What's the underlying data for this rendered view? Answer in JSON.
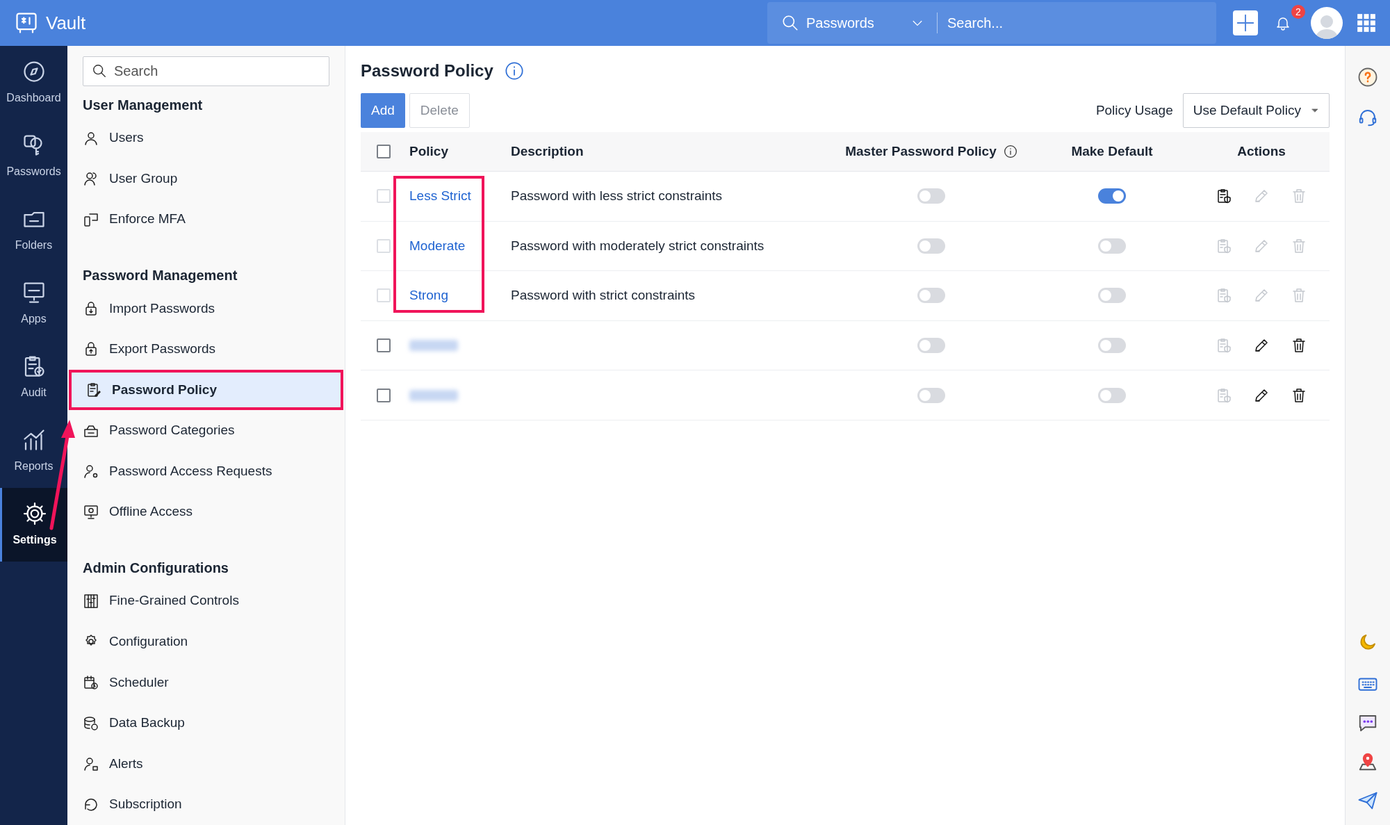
{
  "app": {
    "name": "Vault"
  },
  "top_bar": {
    "search_scope": "Passwords",
    "search_placeholder": "Search...",
    "notification_count": "2"
  },
  "nav_rail": [
    {
      "label": "Dashboard",
      "selected": false
    },
    {
      "label": "Passwords",
      "selected": false
    },
    {
      "label": "Folders",
      "selected": false
    },
    {
      "label": "Apps",
      "selected": false
    },
    {
      "label": "Audit",
      "selected": false
    },
    {
      "label": "Reports",
      "selected": false
    },
    {
      "label": "Settings",
      "selected": true
    }
  ],
  "settings_menu": {
    "search_placeholder": "Search",
    "sections": [
      {
        "title": "User Management",
        "items": [
          {
            "label": "Users",
            "selected": false
          },
          {
            "label": "User Group",
            "selected": false
          },
          {
            "label": "Enforce MFA",
            "selected": false
          }
        ]
      },
      {
        "title": "Password Management",
        "items": [
          {
            "label": "Import Passwords",
            "selected": false
          },
          {
            "label": "Export Passwords",
            "selected": false
          },
          {
            "label": "Password Policy",
            "selected": true
          },
          {
            "label": "Password Categories",
            "selected": false
          },
          {
            "label": "Password Access Requests",
            "selected": false
          },
          {
            "label": "Offline Access",
            "selected": false
          }
        ]
      },
      {
        "title": "Admin Configurations",
        "items": [
          {
            "label": "Fine-Grained Controls",
            "selected": false
          },
          {
            "label": "Configuration",
            "selected": false
          },
          {
            "label": "Scheduler",
            "selected": false
          },
          {
            "label": "Data Backup",
            "selected": false
          },
          {
            "label": "Alerts",
            "selected": false
          },
          {
            "label": "Subscription",
            "selected": false
          }
        ]
      }
    ]
  },
  "page": {
    "title": "Password Policy",
    "buttons": [
      {
        "label": "Add",
        "disabled": false
      },
      {
        "label": "Delete",
        "disabled": true
      }
    ],
    "policy_usage": {
      "label": "Policy Usage",
      "value": "Use Default Policy"
    }
  },
  "table": {
    "select_all_checked": false,
    "columns": [
      "Policy",
      "Description",
      "Master Password Policy",
      "Make Default",
      "Actions"
    ],
    "rows": [
      {
        "policy": "Less Strict",
        "description": "Password with less strict constraints",
        "checkbox_disabled": true,
        "master_password_policy": false,
        "make_default": true,
        "view_enabled": true,
        "edit_enabled": false,
        "delete_enabled": false
      },
      {
        "policy": "Moderate",
        "description": "Password with moderately strict constraints",
        "checkbox_disabled": true,
        "master_password_policy": false,
        "make_default": false,
        "view_enabled": false,
        "edit_enabled": false,
        "delete_enabled": false
      },
      {
        "policy": "Strong",
        "description": "Password with strict constraints",
        "checkbox_disabled": true,
        "master_password_policy": false,
        "make_default": false,
        "view_enabled": false,
        "edit_enabled": false,
        "delete_enabled": false
      },
      {
        "policy_blurred": true,
        "checkbox_disabled": false,
        "master_password_policy": false,
        "make_default": false,
        "view_enabled": false,
        "edit_enabled": true,
        "delete_enabled": true
      },
      {
        "policy_blurred": true,
        "checkbox_disabled": false,
        "master_password_policy": false,
        "make_default": false,
        "view_enabled": false,
        "edit_enabled": true,
        "delete_enabled": true
      }
    ]
  }
}
